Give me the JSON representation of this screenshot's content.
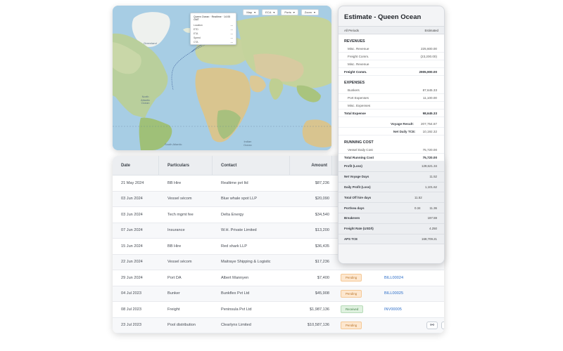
{
  "map": {
    "toolbar": [
      {
        "label": "Map"
      },
      {
        "label": "ECA"
      },
      {
        "label": "Ports"
      },
      {
        "label": "Zoom"
      }
    ],
    "popup": {
      "title": "Queen Ocean · Realtime · 14:05 GMT",
      "rows": [
        {
          "k": "Location",
          "v": "—"
        },
        {
          "k": "ETD",
          "v": "—"
        },
        {
          "k": "ETA",
          "v": "—"
        },
        {
          "k": "Speed",
          "v": "—"
        },
        {
          "k": "CTA",
          "v": "—"
        }
      ]
    },
    "labels": {
      "greenland": "Greenland",
      "north_atlantic": "North\nAtlantic\nOcean",
      "indian_ocean": "Indian\nOcean",
      "south_atlantic": "South\nAtlantic"
    }
  },
  "table": {
    "headers": {
      "date": "Date",
      "particulars": "Particulars",
      "contact": "Contact",
      "amount": "Amount"
    },
    "rows": [
      {
        "date": "21 May 2024",
        "particulars": "BB Hire",
        "contact": "Realtime pvt ltd",
        "amount": "$87,236",
        "status": "",
        "invoice": ""
      },
      {
        "date": "03 Jun 2024",
        "particulars": "Vessel sécom",
        "contact": "Blue whale spot LLP",
        "amount": "$20,090",
        "status": "",
        "invoice": ""
      },
      {
        "date": "03 Jun 2024",
        "particulars": "Tech mgmt fee",
        "contact": "Delta Energy",
        "amount": "$34,540",
        "status": "",
        "invoice": ""
      },
      {
        "date": "07 Jun 2024",
        "particulars": "Insurance",
        "contact": "W.H. Private Limited",
        "amount": "$13,200",
        "status": "",
        "invoice": ""
      },
      {
        "date": "15 Jun 2024",
        "particulars": "BB Hire",
        "contact": "Red shark LLP",
        "amount": "$36,435",
        "status": "",
        "invoice": ""
      },
      {
        "date": "22 Jun 2024",
        "particulars": "Vessel sécom",
        "contact": "Maitraye Shipping & Logistic",
        "amount": "$17,236",
        "status": "",
        "invoice": ""
      },
      {
        "date": "29 Jun 2024",
        "particulars": "Port DA",
        "contact": "Albert Mannyen",
        "amount": "$7,400",
        "status": "Pending",
        "invoice": "BILL00024"
      },
      {
        "date": "04 Jul 2023",
        "particulars": "Bunker",
        "contact": "Bunkflex Pvt Ltd",
        "amount": "$45,908",
        "status": "Pending",
        "invoice": "BILL00025"
      },
      {
        "date": "08 Jul 2023",
        "particulars": "Freight",
        "contact": "Peninsula Pvt Ltd",
        "amount": "$1,987,136",
        "status": "Received",
        "invoice": "INV00005"
      },
      {
        "date": "23 Jul 2023",
        "particulars": "Pool distribution",
        "contact": "Clearlynx Limited",
        "amount": "$10,587,136",
        "status": "Pending",
        "invoice": ""
      }
    ],
    "actions": [
      {
        "icon": "link-icon",
        "glyph": "⚯"
      },
      {
        "icon": "plus-icon",
        "glyph": "+"
      }
    ]
  },
  "estimate": {
    "title": "Estimate - Queen Ocean",
    "sub_left": "All Periods",
    "sub_right": "Estimated",
    "revenues_title": "REVENUES",
    "revenues": [
      {
        "k": "Misc. Revenue",
        "v": "225,600.00"
      },
      {
        "k": "Freight Comm.",
        "v": "(23,200.00)"
      },
      {
        "k": "Misc. Revenue",
        "v": ""
      }
    ],
    "revenues_total": {
      "k": "Freight Comm.",
      "v": "2905,900.00"
    },
    "expenses_title": "EXPENSES",
    "expenses": [
      {
        "k": "Bunkers",
        "v": "87,645.33"
      },
      {
        "k": "Port Expenses",
        "v": "11,100.00"
      },
      {
        "k": "Misc. Expenses",
        "v": ""
      }
    ],
    "expenses_total": {
      "k": "Total Expense",
      "v": "98,645.33"
    },
    "voyage": [
      {
        "k": "Voyage Result:",
        "v": "207,754.67"
      },
      {
        "k": "Net Daily TCE:",
        "v": "10,192.32"
      }
    ],
    "running_title": "RUNNING COST",
    "running": [
      {
        "k": "Vessel Daily Cost",
        "v": "75,720.00"
      }
    ],
    "running_total": {
      "k": "Total Running Cost",
      "v": "75,720.00"
    },
    "summary": [
      {
        "k": "Profit (Loss)",
        "mid": "",
        "v": "129,621.34"
      },
      {
        "k": "Net Voyage Days",
        "mid": "",
        "v": "11.52"
      },
      {
        "k": "Daily Profit (Loss)",
        "mid": "",
        "v": "1,101.62"
      },
      {
        "k": "Total Off hire days",
        "mid": "11.52",
        "v": ""
      },
      {
        "k": "Port/sea days",
        "mid": "0.34",
        "v": "11.36"
      },
      {
        "k": "Breakeven",
        "mid": "",
        "v": "197.59"
      },
      {
        "k": "Freight Rate (USD/t)",
        "mid": "",
        "v": "4.250"
      },
      {
        "k": "APS TCE",
        "mid": "",
        "v": "169,709.21"
      }
    ]
  }
}
